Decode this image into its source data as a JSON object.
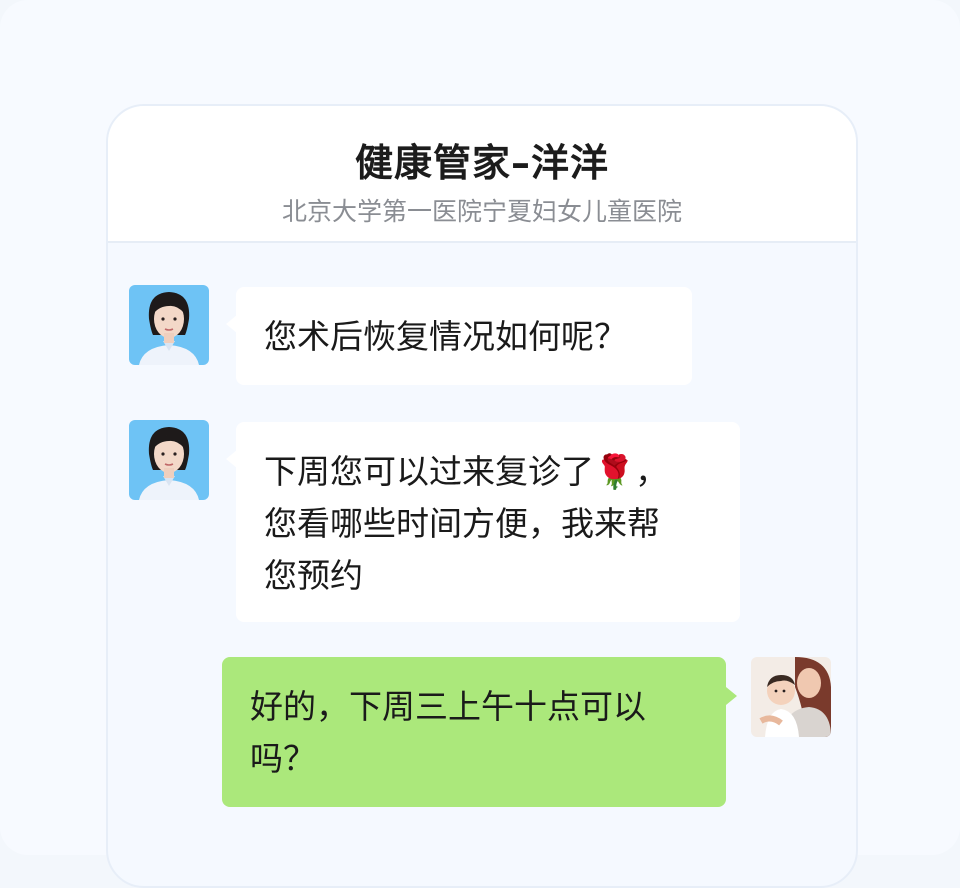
{
  "header": {
    "title": "健康管家–洋洋",
    "subtitle": "北京大学第一医院宁夏妇女儿童医院"
  },
  "messages": [
    {
      "side": "left",
      "avatar_icon": "nurse-avatar",
      "lines": [
        "您术后恢复情况如何呢？"
      ]
    },
    {
      "side": "left",
      "avatar_icon": "nurse-avatar",
      "lines": [
        "下周您可以过来复诊了🌹，",
        "您看哪些时间方便，我来帮",
        "您预约"
      ]
    },
    {
      "side": "right",
      "avatar_icon": "mother-baby-avatar",
      "lines": [
        "好的，下周三上午十点可以",
        "吗？"
      ]
    }
  ],
  "colors": {
    "incoming_bubble": "#ffffff",
    "outgoing_bubble": "#abe87b",
    "background": "#f5f9ff"
  }
}
